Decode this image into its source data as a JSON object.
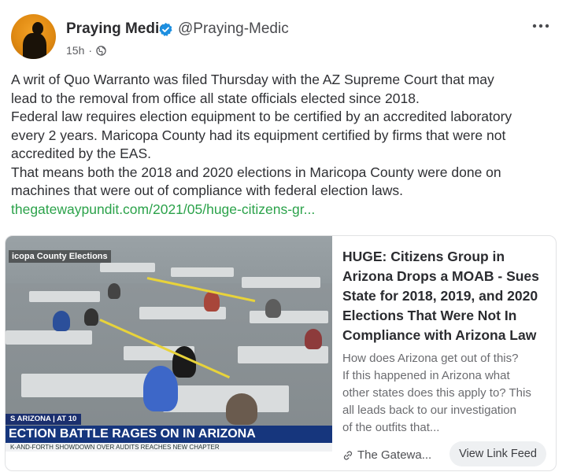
{
  "post": {
    "author_name": "Praying Medic",
    "handle": "@Praying-Medic",
    "time": "15h",
    "meta_separator": "·",
    "icons": {
      "verified": "verified-badge-icon",
      "privacy": "globe-icon",
      "more": "more-options-icon"
    },
    "accent_color": "#2ba24a",
    "text_lines": [
      "A writ of Quo Warranto was filed Thursday with the AZ Supreme Court that may",
      "lead to the removal from office all state officials elected since 2018.",
      "Federal law requires election equipment to be certified by an accredited laboratory",
      "every 2 years. Maricopa County had its equipment certified by firms that were not",
      "accredited by the EAS.",
      "That means both the 2018 and 2020 elections in Maricopa County were done on",
      "machines that were out of compliance with federal election laws."
    ],
    "link_text": "thegatewaypundit.com/2021/05/huge-citizens-gr..."
  },
  "card": {
    "image": {
      "station_badge": "icopa County Elections",
      "chyron_small": "S ARIZONA | AT 10",
      "chyron_main": "ECTION BATTLE RAGES ON IN ARIZONA",
      "chyron_sub": "K-AND-FORTH SHOWDOWN OVER AUDITS REACHES NEW CHAPTER"
    },
    "title_lines": [
      "HUGE: Citizens Group in",
      "Arizona Drops a MOAB - Sues",
      "State for 2018, 2019, and 2020",
      "Elections That Were Not In",
      "Compliance with Arizona Law"
    ],
    "description_lines": [
      "How does Arizona get out of this?",
      "If this happened in Arizona what",
      "other states does this apply to? This",
      "all leads back to our investigation",
      "of the outfits that..."
    ],
    "source": "The Gatewa...",
    "source_icon": "link-icon",
    "button_label": "View Link Feed"
  }
}
